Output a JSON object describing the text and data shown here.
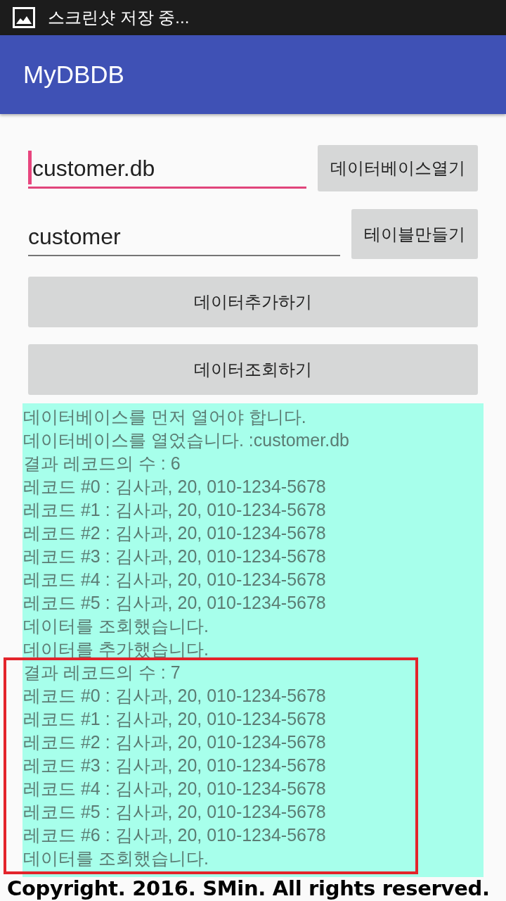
{
  "status_bar": {
    "notification": "스크린샷 저장 중..."
  },
  "app_bar": {
    "title": "MyDBDB"
  },
  "form": {
    "rows": [
      {
        "field": {
          "value": "customer.db",
          "focused": true
        },
        "button": "데이터베이스열기"
      },
      {
        "field": {
          "value": "customer",
          "focused": false
        },
        "button": "테이블만들기"
      }
    ],
    "buttons": [
      "데이터추가하기",
      "데이터조회하기"
    ]
  },
  "log": {
    "lines": [
      "데이터베이스를 먼저 열어야 합니다.",
      "데이터베이스를 열었습니다. :customer.db",
      "결과 레코드의 수 : 6",
      "레코드 #0 : 김사과, 20, 010-1234-5678",
      "레코드 #1 : 김사과, 20, 010-1234-5678",
      "레코드 #2 : 김사과, 20, 010-1234-5678",
      "레코드 #3 : 김사과, 20, 010-1234-5678",
      "레코드 #4 : 김사과, 20, 010-1234-5678",
      "레코드 #5 : 김사과, 20, 010-1234-5678",
      "데이터를 조회했습니다.",
      "데이터를 추가했습니다."
    ],
    "highlighted_lines": [
      "결과 레코드의 수 : 7",
      "레코드 #0 : 김사과, 20, 010-1234-5678",
      "레코드 #1 : 김사과, 20, 010-1234-5678",
      "레코드 #2 : 김사과, 20, 010-1234-5678",
      "레코드 #3 : 김사과, 20, 010-1234-5678",
      "레코드 #4 : 김사과, 20, 010-1234-5678",
      "레코드 #5 : 김사과, 20, 010-1234-5678",
      "레코드 #6 : 김사과, 20, 010-1234-5678",
      "데이터를 조회했습니다."
    ]
  },
  "footer": {
    "caption": "Copyright. 2016. SMin. All rights reserved."
  }
}
